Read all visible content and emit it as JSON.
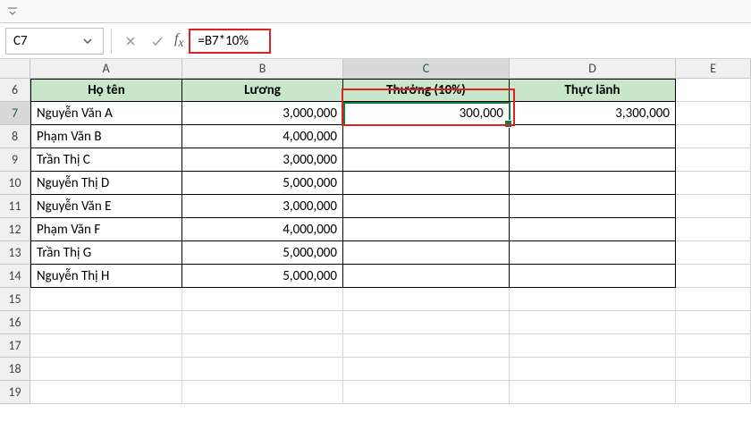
{
  "namebox": {
    "value": "C7"
  },
  "formula": {
    "value": "=B7*10%"
  },
  "columns": [
    "A",
    "B",
    "C",
    "D",
    "E"
  ],
  "row_start": 6,
  "row_end": 19,
  "selected_row": 7,
  "selected_col": "C",
  "headers": {
    "A": "Họ tên",
    "B": "Lương",
    "C": "Thưởng (10%)",
    "D": "Thực lãnh"
  },
  "rows": [
    {
      "name": "Nguyễn Văn A",
      "luong": "3,000,000",
      "thuong": "300,000",
      "thuclanh": "3,300,000"
    },
    {
      "name": "Phạm Văn B",
      "luong": "4,000,000",
      "thuong": "",
      "thuclanh": ""
    },
    {
      "name": "Trần Thị C",
      "luong": "3,000,000",
      "thuong": "",
      "thuclanh": ""
    },
    {
      "name": "Nguyễn Thị D",
      "luong": "5,000,000",
      "thuong": "",
      "thuclanh": ""
    },
    {
      "name": "Nguyễn Văn E",
      "luong": "3,000,000",
      "thuong": "",
      "thuclanh": ""
    },
    {
      "name": "Phạm Văn F",
      "luong": "4,000,000",
      "thuong": "",
      "thuclanh": ""
    },
    {
      "name": "Trần Thị G",
      "luong": "5,000,000",
      "thuong": "",
      "thuclanh": ""
    },
    {
      "name": "Nguyễn Thị H",
      "luong": "5,000,000",
      "thuong": "",
      "thuclanh": ""
    }
  ],
  "colors": {
    "header_bg": "#c8e6c9",
    "selection": "#107c41",
    "highlight": "#e02020"
  },
  "chart_data": {
    "type": "table",
    "title": "",
    "columns": [
      "Họ tên",
      "Lương",
      "Thưởng (10%)",
      "Thực lãnh"
    ],
    "data": [
      [
        "Nguyễn Văn A",
        3000000,
        300000,
        3300000
      ],
      [
        "Phạm Văn B",
        4000000,
        null,
        null
      ],
      [
        "Trần Thị C",
        3000000,
        null,
        null
      ],
      [
        "Nguyễn Thị D",
        5000000,
        null,
        null
      ],
      [
        "Nguyễn Văn E",
        3000000,
        null,
        null
      ],
      [
        "Phạm Văn F",
        4000000,
        null,
        null
      ],
      [
        "Trần Thị G",
        5000000,
        null,
        null
      ],
      [
        "Nguyễn Thị H",
        5000000,
        null,
        null
      ]
    ]
  }
}
